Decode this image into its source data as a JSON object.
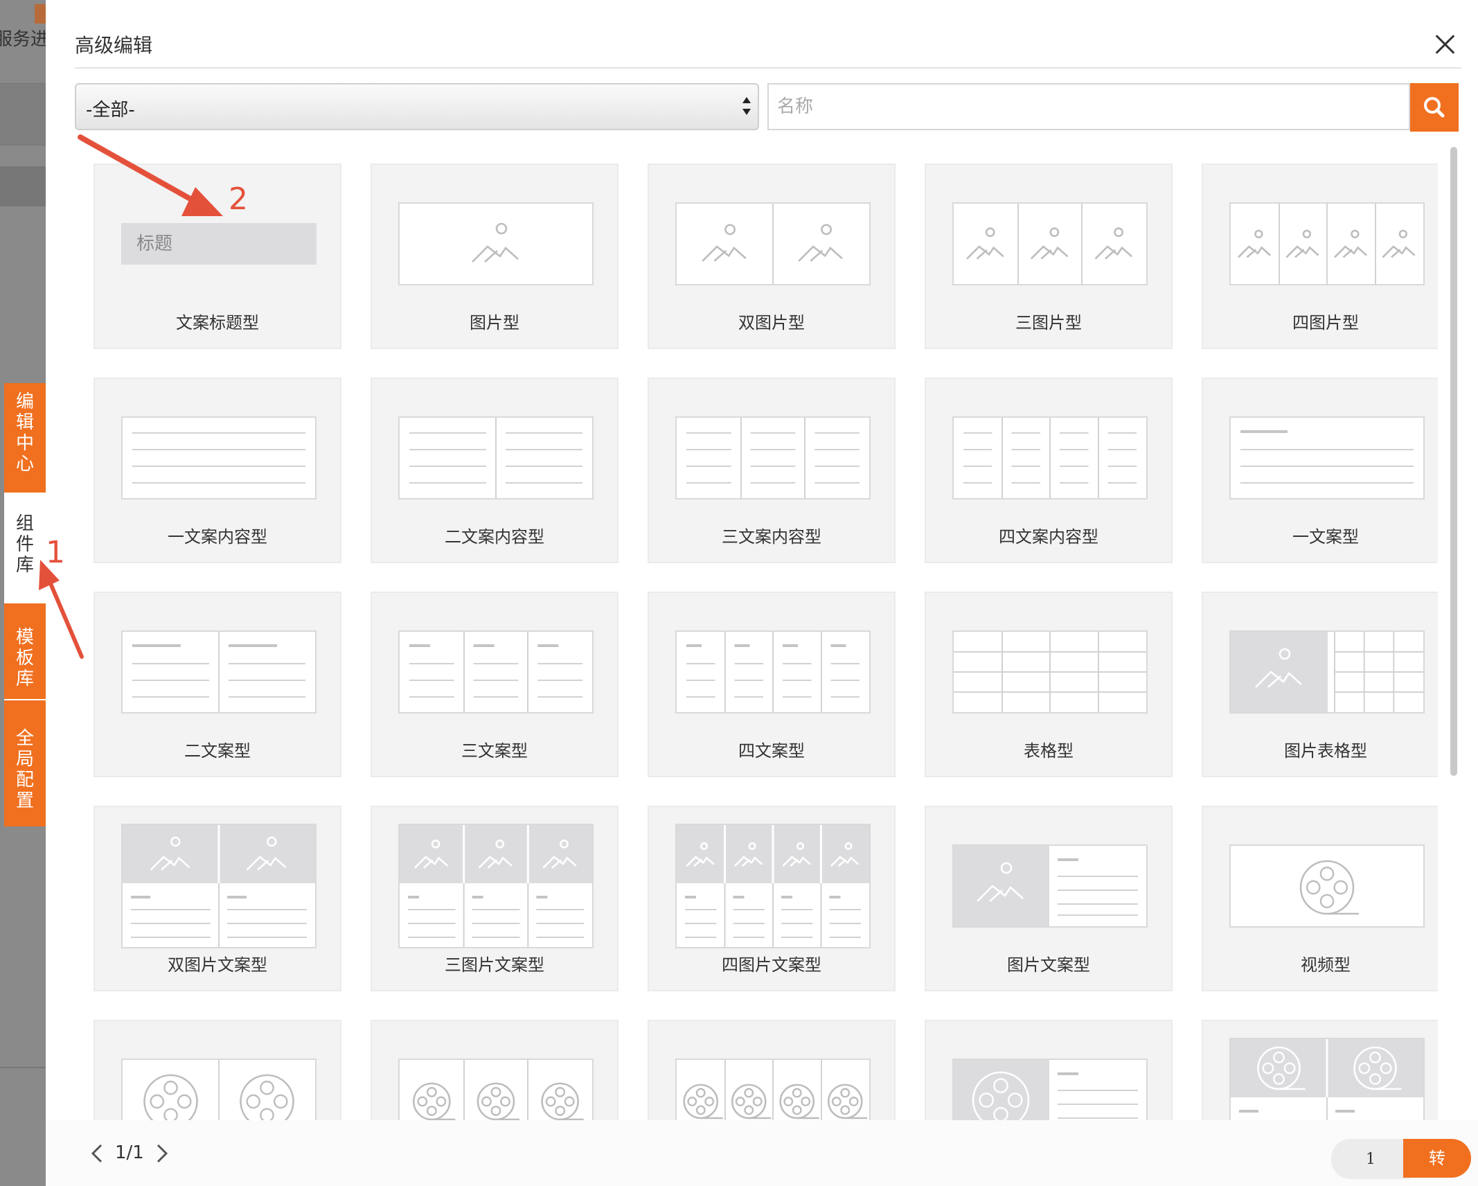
{
  "background": {
    "text": "服务进度"
  },
  "dialog": {
    "title": "高级编辑",
    "filter": {
      "selected": "-全部-"
    },
    "search": {
      "placeholder": "名称"
    }
  },
  "sidebar": {
    "tabs": [
      {
        "label": "编辑中心",
        "active": false
      },
      {
        "label": "组件库",
        "active": true
      },
      {
        "label": "模板库",
        "active": false
      },
      {
        "label": "全局配置",
        "active": false
      }
    ]
  },
  "components": [
    {
      "label": "文案标题型",
      "preview": "title",
      "title_text": "标题"
    },
    {
      "label": "图片型",
      "preview": "img",
      "n": 1
    },
    {
      "label": "双图片型",
      "preview": "img",
      "n": 2
    },
    {
      "label": "三图片型",
      "preview": "img",
      "n": 3
    },
    {
      "label": "四图片型",
      "preview": "img",
      "n": 4
    },
    {
      "label": "一文案内容型",
      "preview": "text",
      "n": 1
    },
    {
      "label": "二文案内容型",
      "preview": "text",
      "n": 2
    },
    {
      "label": "三文案内容型",
      "preview": "text",
      "n": 3
    },
    {
      "label": "四文案内容型",
      "preview": "text",
      "n": 4
    },
    {
      "label": "一文案型",
      "preview": "textdash",
      "n": 1
    },
    {
      "label": "二文案型",
      "preview": "textdash",
      "n": 2
    },
    {
      "label": "三文案型",
      "preview": "textdash",
      "n": 3
    },
    {
      "label": "四文案型",
      "preview": "textdash",
      "n": 4
    },
    {
      "label": "表格型",
      "preview": "table"
    },
    {
      "label": "图片表格型",
      "preview": "imgtable"
    },
    {
      "label": "双图片文案型",
      "preview": "imgtext",
      "n": 2
    },
    {
      "label": "三图片文案型",
      "preview": "imgtext",
      "n": 3
    },
    {
      "label": "四图片文案型",
      "preview": "imgtext",
      "n": 4
    },
    {
      "label": "图片文案型",
      "preview": "imgside"
    },
    {
      "label": "视频型",
      "preview": "video",
      "n": 1
    },
    {
      "label": "",
      "preview": "video",
      "n": 2
    },
    {
      "label": "",
      "preview": "video",
      "n": 3
    },
    {
      "label": "",
      "preview": "video",
      "n": 4
    },
    {
      "label": "",
      "preview": "videoside"
    },
    {
      "label": "",
      "preview": "videotext",
      "n": 2
    }
  ],
  "pagination": {
    "page_text": "1/1",
    "input_value": "1",
    "go_label": "转"
  },
  "annotations": {
    "marker_1": "1",
    "marker_2": "2"
  },
  "colors": {
    "accent": "#f07020",
    "annotation": "#e4513b"
  }
}
